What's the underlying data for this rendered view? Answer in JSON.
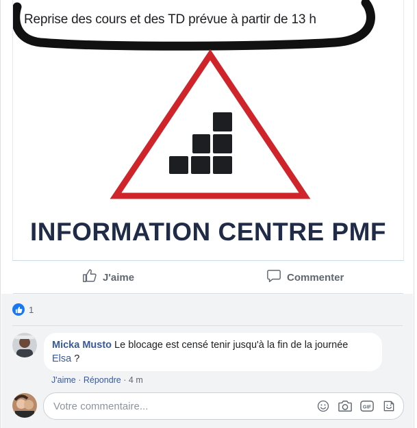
{
  "post": {
    "image": {
      "caption_text": "Reprise des cours et des TD prévue à partir de 13 h",
      "title": "INFORMATION CENTRE PMF"
    },
    "actions": {
      "like_label": "J'aime",
      "comment_label": "Commenter"
    },
    "reactions": {
      "count": "1",
      "icon": "like-icon",
      "color": "#1877f2"
    },
    "comments": [
      {
        "author": "Micka Musto",
        "text_line1": " Le blocage est censé tenir jusqu'à la fin de la journée",
        "mention": "Elsa",
        "text_line2_suffix": " ?",
        "like_link": "J'aime",
        "reply_link": "Répondre",
        "time": "4 m"
      }
    ],
    "composer": {
      "placeholder": "Votre commentaire...",
      "icons": [
        "emoji-icon",
        "camera-icon",
        "gif-icon",
        "sticker-icon"
      ]
    },
    "colors": {
      "link": "#385898",
      "triangle_red": "#d0242b",
      "title_navy": "#1f2b47"
    }
  }
}
